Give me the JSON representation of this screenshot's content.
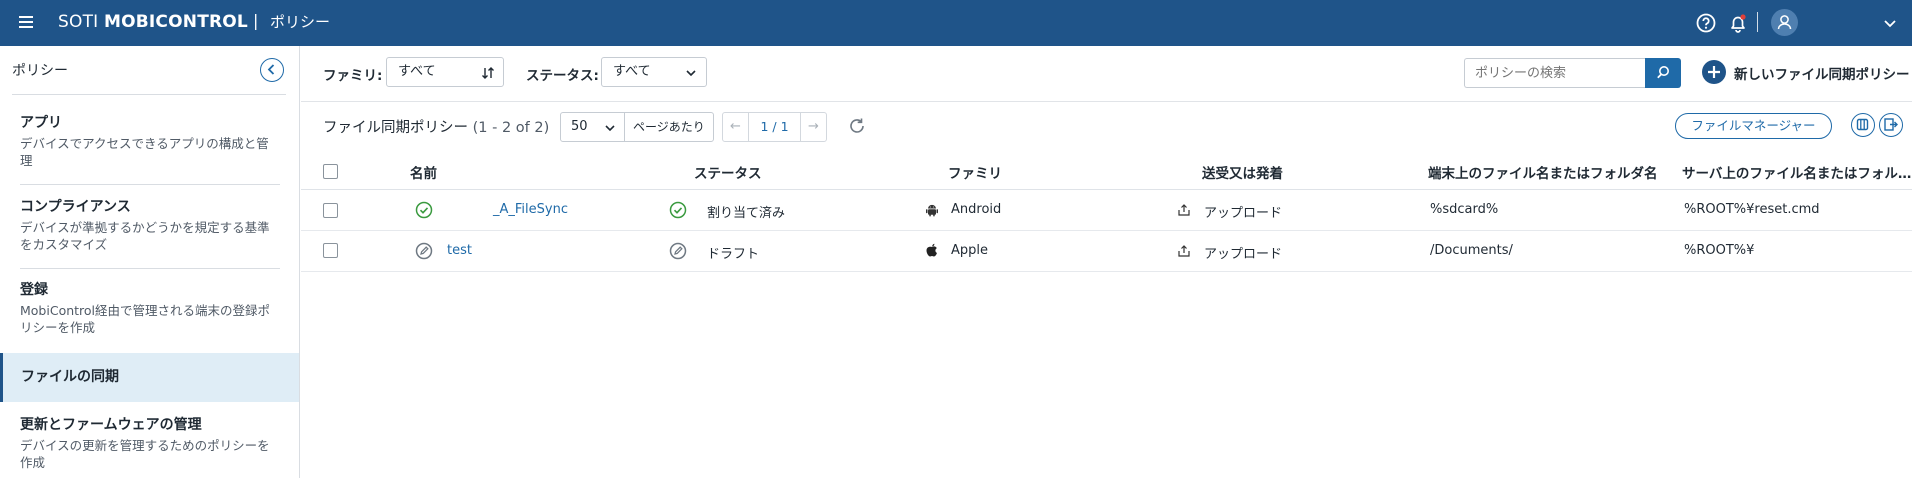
{
  "header": {
    "brand_left": "SOTI ",
    "brand_right": "MOBICONTROL",
    "separator": "|",
    "page_title": "ポリシー",
    "icons": [
      "menu-icon",
      "help-icon",
      "bell-icon",
      "user-icon",
      "chevron-down-icon"
    ],
    "notification_dot_color": "#e0403a"
  },
  "sidebar": {
    "title": "ポリシー",
    "items": [
      {
        "title": "アプリ",
        "desc": "デバイスでアクセスできるアプリの構成と管理"
      },
      {
        "title": "コンプライアンス",
        "desc": "デバイスが準拠するかどうかを規定する基準をカスタマイズ"
      },
      {
        "title": "登録",
        "desc": "MobiControl経由で管理される端末の登録ポリシーを作成"
      },
      {
        "title": "ファイルの同期",
        "desc": ""
      },
      {
        "title": "更新とファームウェアの管理",
        "desc": "デバイスの更新を管理するためのポリシーを作成"
      }
    ],
    "active_index": 3
  },
  "toolbar": {
    "family_label": "ファミリ:",
    "family_value": "すべて",
    "status_label": "ステータス:",
    "status_value": "すべて",
    "search_placeholder": "ポリシーの検索",
    "new_button": "新しいファイル同期ポリシー"
  },
  "list": {
    "title": "ファイル同期ポリシー",
    "count": "(1 - 2 of 2)",
    "per_page": "50",
    "per_page_label": "ページあたり",
    "page": "1 / 1",
    "file_manager_button": "ファイルマネージャー"
  },
  "table": {
    "columns": [
      "名前",
      "ステータス",
      "ファミリ",
      "送受又は発着",
      "端末上のファイル名またはフォルダ名",
      "サーバ上のファイル名またはフォル…"
    ],
    "rows": [
      {
        "name": "_A_FileSync",
        "status": "割り当て済み",
        "status_icon": "check-circle-icon",
        "family": "Android",
        "family_icon": "android-icon",
        "direction": "アップロード",
        "device_path": "%sdcard%",
        "server_path": "%ROOT%¥reset.cmd"
      },
      {
        "name": "test",
        "status": "ドラフト",
        "status_icon": "pencil-circle-icon",
        "family": "Apple",
        "family_icon": "apple-icon",
        "direction": "アップロード",
        "device_path": "/Documents/",
        "server_path": "%ROOT%¥"
      }
    ]
  },
  "colors": {
    "header_bg": "#1f5489",
    "accent": "#1f6aa8",
    "status_green": "#3a9a3f",
    "active_item_bg": "#dfedf6"
  }
}
